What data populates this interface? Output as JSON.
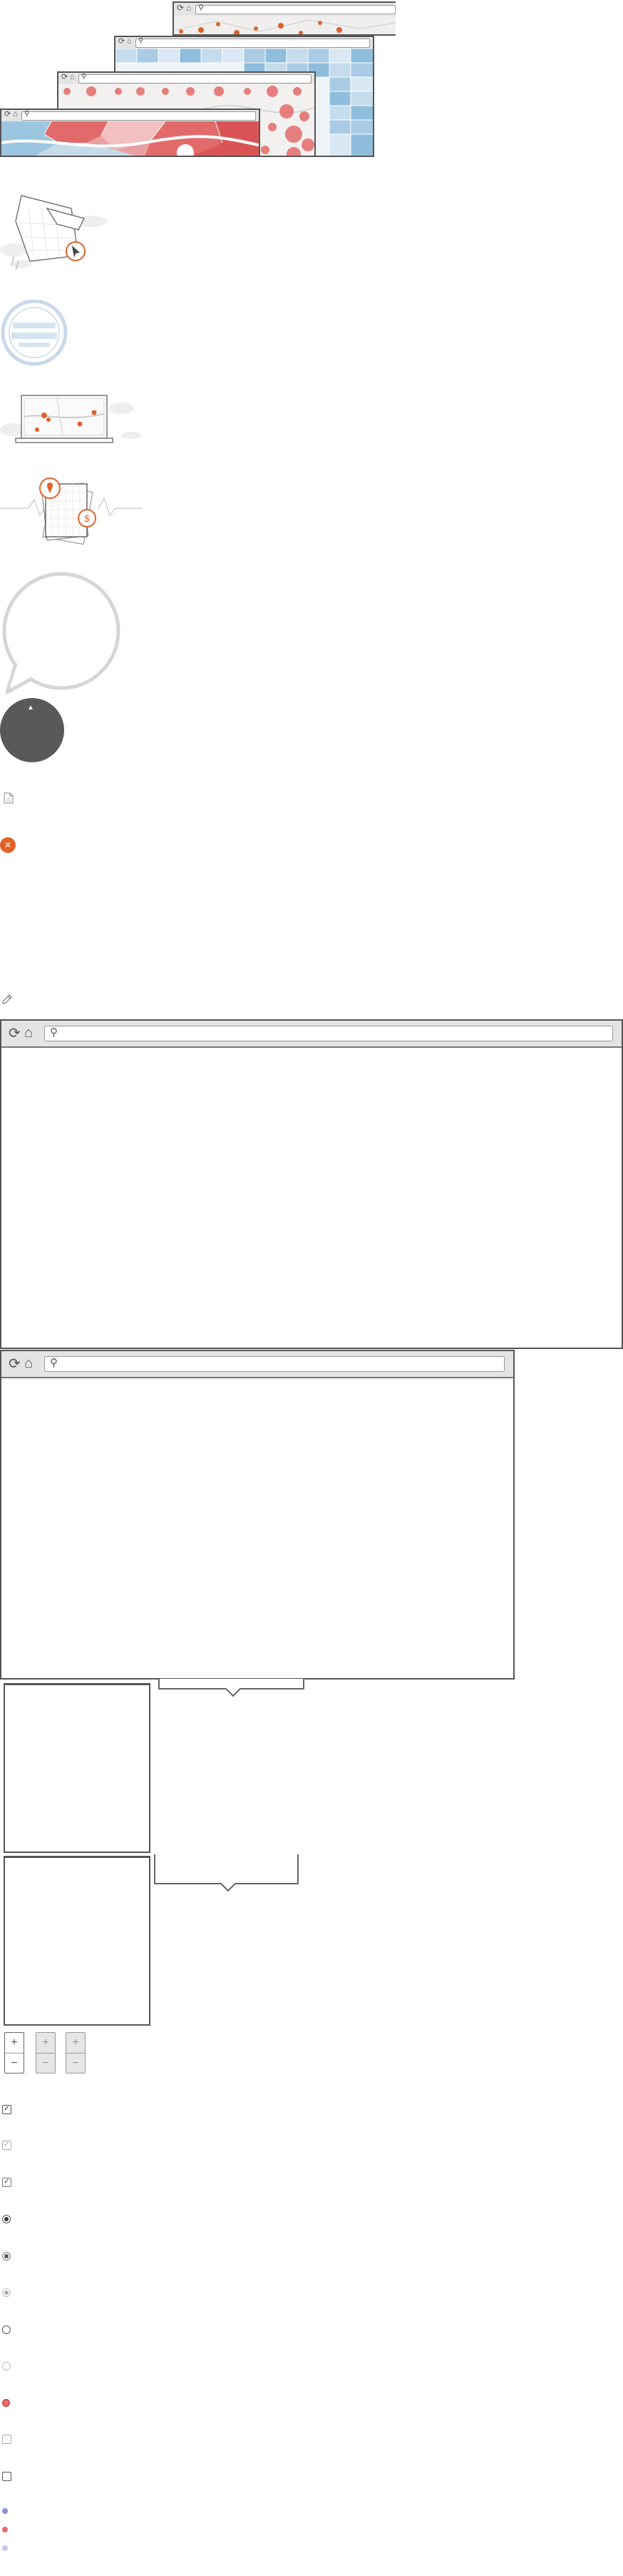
{
  "browser_frames": [
    {
      "reload": "⟳",
      "home": "⌂",
      "search": "⚲"
    },
    {
      "reload": "⟳",
      "home": "⌂",
      "search": "⚲"
    },
    {
      "reload": "⟳",
      "home": "⌂",
      "search": "⚲"
    },
    {
      "reload": "⟳",
      "home": "⌂",
      "search": "⚲"
    }
  ],
  "large_browsers": [
    {
      "reload": "⟳",
      "home": "⌂",
      "search": "⚲"
    },
    {
      "reload": "⟳",
      "home": "⌂",
      "search": "⚲"
    }
  ],
  "zoom_controls": [
    {
      "plus": "+",
      "minus": "−",
      "state": "default"
    },
    {
      "plus": "+",
      "minus": "−",
      "state": "disabled"
    },
    {
      "plus": "+",
      "minus": "−",
      "state": "disabled"
    }
  ],
  "checkboxes": [
    {
      "checked": true,
      "style": "dark"
    },
    {
      "checked": true,
      "style": "light"
    },
    {
      "checked": true,
      "style": "medium"
    }
  ],
  "radios": [
    {
      "checked": true,
      "style": "dark"
    },
    {
      "checked": true,
      "style": "medium"
    },
    {
      "checked": true,
      "style": "light"
    },
    {
      "checked": false,
      "style": "dark"
    },
    {
      "checked": false,
      "style": "light"
    }
  ],
  "colors": {
    "accent_orange": "#e0622a",
    "map_red": "#e36a6a",
    "map_blue": "#9cc6e0",
    "dark_circle": "#595959",
    "stamp_blue": "#c9d9ea",
    "frame_grey": "#555555"
  },
  "icons": {
    "check": "✓",
    "close": "✕",
    "pencil": "✎",
    "cursor": "➤",
    "up_arrow": "▲",
    "pin": "●",
    "dollar": "$"
  }
}
